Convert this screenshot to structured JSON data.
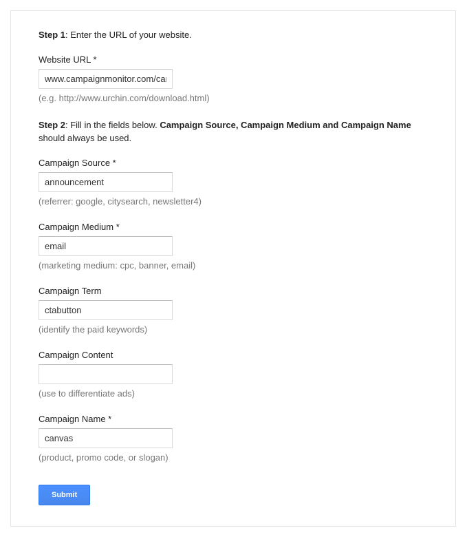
{
  "step1": {
    "prefix": "Step 1",
    "text": ": Enter the URL of your website."
  },
  "websiteUrl": {
    "label": "Website URL *",
    "value": "www.campaignmonitor.com/canvas",
    "hint": "(e.g. http://www.urchin.com/download.html)"
  },
  "step2": {
    "prefix": "Step 2",
    "text1": ": Fill in the fields below. ",
    "bold": "Campaign Source, Campaign Medium and Campaign Name",
    "text2": " should always be used."
  },
  "campaignSource": {
    "label": "Campaign Source *",
    "value": "announcement",
    "hint": "(referrer: google, citysearch, newsletter4)"
  },
  "campaignMedium": {
    "label": "Campaign Medium *",
    "value": "email",
    "hint": "(marketing medium: cpc, banner, email)"
  },
  "campaignTerm": {
    "label": "Campaign Term",
    "value": "ctabutton",
    "hint": "(identify the paid keywords)"
  },
  "campaignContent": {
    "label": "Campaign Content",
    "value": "",
    "hint": "(use to differentiate ads)"
  },
  "campaignName": {
    "label": "Campaign Name *",
    "value": "canvas",
    "hint": "(product, promo code, or slogan)"
  },
  "submit": {
    "label": "Submit"
  }
}
